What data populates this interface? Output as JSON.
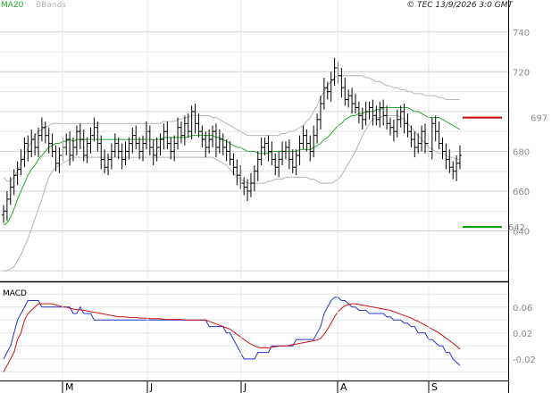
{
  "header": {
    "legend": [
      {
        "label": "MA20",
        "color": "#22aa22"
      },
      {
        "label": "BBands",
        "color": "#b4b4b4"
      }
    ],
    "copyright": "© TEC 13/9/2026 3:0 GMT"
  },
  "colors": {
    "price": "#000000",
    "ma20": "#22aa22",
    "bbands": "#b4b4b4",
    "macd": "#2233cc",
    "signal": "#cc1111",
    "resistance": "#cc0000",
    "support": "#009900",
    "grid": "#cfcfcf"
  },
  "chart_data": [
    {
      "type": "ohlc",
      "x_months": [
        "M",
        "J",
        "J",
        "A",
        "S"
      ],
      "ylim": [
        616,
        748
      ],
      "y_ticks": [
        640,
        660,
        680,
        700,
        720,
        740
      ],
      "y_tick_labels": [
        "640",
        "660",
        "680",
        "",
        "720",
        "740"
      ],
      "resistance": {
        "value": 697,
        "label": "697"
      },
      "support": {
        "value": 642,
        "label": "642"
      },
      "close": [
        650,
        656,
        662,
        668,
        671,
        676,
        684,
        680,
        686,
        682,
        688,
        692,
        688,
        684,
        680,
        674,
        678,
        682,
        686,
        678,
        682,
        690,
        686,
        678,
        684,
        688,
        692,
        684,
        676,
        672,
        676,
        680,
        684,
        680,
        676,
        680,
        684,
        688,
        684,
        680,
        684,
        690,
        682,
        678,
        682,
        686,
        690,
        684,
        680,
        684,
        692,
        688,
        694,
        690,
        700,
        694,
        690,
        686,
        682,
        686,
        690,
        682,
        686,
        682,
        680,
        676,
        672,
        668,
        664,
        662,
        660,
        664,
        670,
        676,
        682,
        684,
        680,
        676,
        672,
        676,
        680,
        682,
        676,
        672,
        678,
        684,
        688,
        684,
        680,
        688,
        696,
        704,
        712,
        710,
        716,
        722,
        718,
        712,
        706,
        708,
        704,
        702,
        698,
        696,
        700,
        702,
        698,
        696,
        702,
        698,
        694,
        692,
        690,
        696,
        700,
        694,
        690,
        686,
        682,
        684,
        690,
        684,
        680,
        694,
        690,
        684,
        680,
        676,
        672,
        670,
        674,
        678
      ],
      "ma20": [
        643,
        644,
        647,
        651,
        656,
        660,
        664,
        668,
        671,
        673,
        676,
        678,
        680,
        682,
        683,
        684,
        684,
        685,
        685,
        686,
        685,
        686,
        686,
        686,
        686,
        686,
        686,
        686,
        686,
        686,
        686,
        686,
        686,
        686,
        686,
        686,
        686,
        686,
        686,
        686,
        686,
        686,
        686,
        686,
        686,
        686,
        687,
        687,
        687,
        687,
        687,
        687,
        687,
        687,
        688,
        688,
        688,
        688,
        688,
        688,
        688,
        687,
        687,
        686,
        685,
        684,
        683,
        682,
        682,
        681,
        680,
        680,
        680,
        679,
        679,
        679,
        679,
        680,
        680,
        680,
        680,
        680,
        680,
        680,
        680,
        681,
        681,
        681,
        681,
        682,
        683,
        684,
        686,
        687,
        689,
        691,
        693,
        694,
        696,
        697,
        698,
        698,
        699,
        699,
        700,
        700,
        700,
        701,
        701,
        702,
        702,
        702,
        702,
        702,
        702,
        702,
        702,
        701,
        700,
        700,
        699,
        698,
        697,
        697,
        697,
        697,
        696,
        695,
        694,
        693,
        692,
        691
      ],
      "bb_upper": [
        667,
        665,
        665,
        667,
        670,
        674,
        678,
        682,
        685,
        688,
        690,
        691,
        692,
        693,
        694,
        694,
        694,
        694,
        694,
        694,
        694,
        694,
        694,
        694,
        694,
        694,
        694,
        694,
        694,
        694,
        694,
        694,
        694,
        694,
        694,
        694,
        694,
        694,
        694,
        694,
        694,
        694,
        694,
        694,
        694,
        694,
        695,
        695,
        695,
        695,
        696,
        696,
        697,
        697,
        698,
        698,
        698,
        698,
        698,
        698,
        697,
        697,
        696,
        695,
        694,
        693,
        692,
        691,
        690,
        689,
        688,
        688,
        688,
        688,
        688,
        688,
        688,
        688,
        688,
        688,
        689,
        689,
        690,
        690,
        691,
        692,
        693,
        695,
        697,
        700,
        703,
        707,
        710,
        713,
        715,
        717,
        718,
        718,
        718,
        718,
        718,
        718,
        718,
        718,
        717,
        717,
        716,
        715,
        715,
        714,
        713,
        713,
        712,
        712,
        711,
        711,
        710,
        710,
        709,
        709,
        709,
        708,
        708,
        708,
        708,
        707,
        707,
        706,
        706,
        706,
        706,
        706
      ],
      "bb_lower": [
        620,
        620,
        621,
        622,
        625,
        628,
        632,
        636,
        641,
        646,
        651,
        656,
        662,
        667,
        670,
        672,
        673,
        674,
        675,
        676,
        677,
        677,
        677,
        677,
        677,
        677,
        677,
        677,
        677,
        677,
        677,
        677,
        677,
        677,
        677,
        677,
        677,
        677,
        677,
        677,
        677,
        677,
        677,
        677,
        677,
        677,
        677,
        677,
        677,
        677,
        677,
        677,
        677,
        677,
        677,
        677,
        677,
        677,
        677,
        677,
        677,
        676,
        675,
        674,
        673,
        671,
        669,
        667,
        666,
        665,
        664,
        664,
        664,
        664,
        664,
        664,
        665,
        665,
        666,
        666,
        666,
        667,
        667,
        667,
        667,
        667,
        667,
        667,
        666,
        666,
        665,
        664,
        664,
        664,
        664,
        665,
        666,
        668,
        671,
        674,
        677,
        680,
        684,
        688,
        691,
        694,
        696,
        697,
        697,
        698,
        698,
        698,
        698,
        698,
        697,
        696,
        694,
        692,
        690,
        688,
        686,
        684,
        682,
        681,
        680,
        679,
        679,
        678,
        677,
        677,
        676,
        676
      ],
      "macd": [
        -0.02,
        -0.01,
        0.0,
        0.02,
        0.04,
        0.05,
        0.06,
        0.07,
        0.07,
        0.07,
        0.07,
        0.06,
        0.06,
        0.06,
        0.06,
        0.06,
        0.06,
        0.06,
        0.06,
        0.06,
        0.05,
        0.05,
        0.06,
        0.05,
        0.05,
        0.05,
        0.04,
        0.04,
        0.04,
        0.04,
        0.04,
        0.04,
        0.04,
        0.04,
        0.04,
        0.04,
        0.04,
        0.04,
        0.04,
        0.04,
        0.04,
        0.04,
        0.04,
        0.04,
        0.04,
        0.04,
        0.04,
        0.04,
        0.04,
        0.04,
        0.04,
        0.04,
        0.04,
        0.04,
        0.04,
        0.04,
        0.04,
        0.04,
        0.04,
        0.03,
        0.03,
        0.03,
        0.03,
        0.03,
        0.02,
        0.02,
        0.01,
        0.0,
        -0.01,
        -0.02,
        -0.02,
        -0.02,
        -0.02,
        -0.01,
        -0.01,
        -0.01,
        -0.01,
        0.0,
        0.0,
        0.0,
        0.0,
        0.0,
        0.0,
        0.0,
        0.01,
        0.01,
        0.01,
        0.01,
        0.01,
        0.01,
        0.02,
        0.03,
        0.05,
        0.06,
        0.07,
        0.075,
        0.075,
        0.07,
        0.07,
        0.065,
        0.06,
        0.06,
        0.055,
        0.055,
        0.055,
        0.05,
        0.05,
        0.05,
        0.05,
        0.05,
        0.045,
        0.045,
        0.04,
        0.04,
        0.04,
        0.035,
        0.035,
        0.03,
        0.03,
        0.02,
        0.02,
        0.02,
        0.01,
        0.01,
        0.005,
        0.0,
        0.0,
        -0.01,
        -0.01,
        -0.02,
        -0.025,
        -0.03
      ],
      "signal": [
        -0.04,
        -0.03,
        -0.02,
        -0.01,
        0.01,
        0.02,
        0.04,
        0.05,
        0.055,
        0.06,
        0.065,
        0.065,
        0.065,
        0.065,
        0.065,
        0.063,
        0.062,
        0.06,
        0.06,
        0.058,
        0.057,
        0.056,
        0.056,
        0.055,
        0.054,
        0.053,
        0.052,
        0.051,
        0.05,
        0.049,
        0.048,
        0.047,
        0.046,
        0.045,
        0.045,
        0.045,
        0.044,
        0.044,
        0.044,
        0.043,
        0.043,
        0.043,
        0.042,
        0.042,
        0.042,
        0.042,
        0.041,
        0.041,
        0.041,
        0.041,
        0.041,
        0.041,
        0.04,
        0.04,
        0.04,
        0.04,
        0.04,
        0.04,
        0.04,
        0.038,
        0.036,
        0.034,
        0.032,
        0.03,
        0.028,
        0.026,
        0.022,
        0.018,
        0.014,
        0.01,
        0.006,
        0.003,
        0.0,
        -0.002,
        -0.003,
        -0.003,
        -0.003,
        -0.002,
        -0.001,
        0.0,
        0.0,
        0.0,
        0.001,
        0.002,
        0.003,
        0.004,
        0.005,
        0.006,
        0.007,
        0.008,
        0.009,
        0.012,
        0.018,
        0.026,
        0.035,
        0.045,
        0.053,
        0.058,
        0.062,
        0.064,
        0.065,
        0.065,
        0.064,
        0.063,
        0.062,
        0.061,
        0.06,
        0.059,
        0.058,
        0.057,
        0.056,
        0.055,
        0.053,
        0.051,
        0.049,
        0.047,
        0.045,
        0.043,
        0.04,
        0.038,
        0.035,
        0.032,
        0.029,
        0.026,
        0.023,
        0.02,
        0.016,
        0.012,
        0.008,
        0.004,
        0.0,
        -0.005
      ],
      "macd_ylim": [
        -0.045,
        0.09
      ],
      "macd_ticks": [
        -0.02,
        0.02,
        0.06
      ],
      "macd_tick_labels": [
        "-0.02",
        "0.02",
        "0.06"
      ],
      "macd_label": "MACD"
    }
  ]
}
